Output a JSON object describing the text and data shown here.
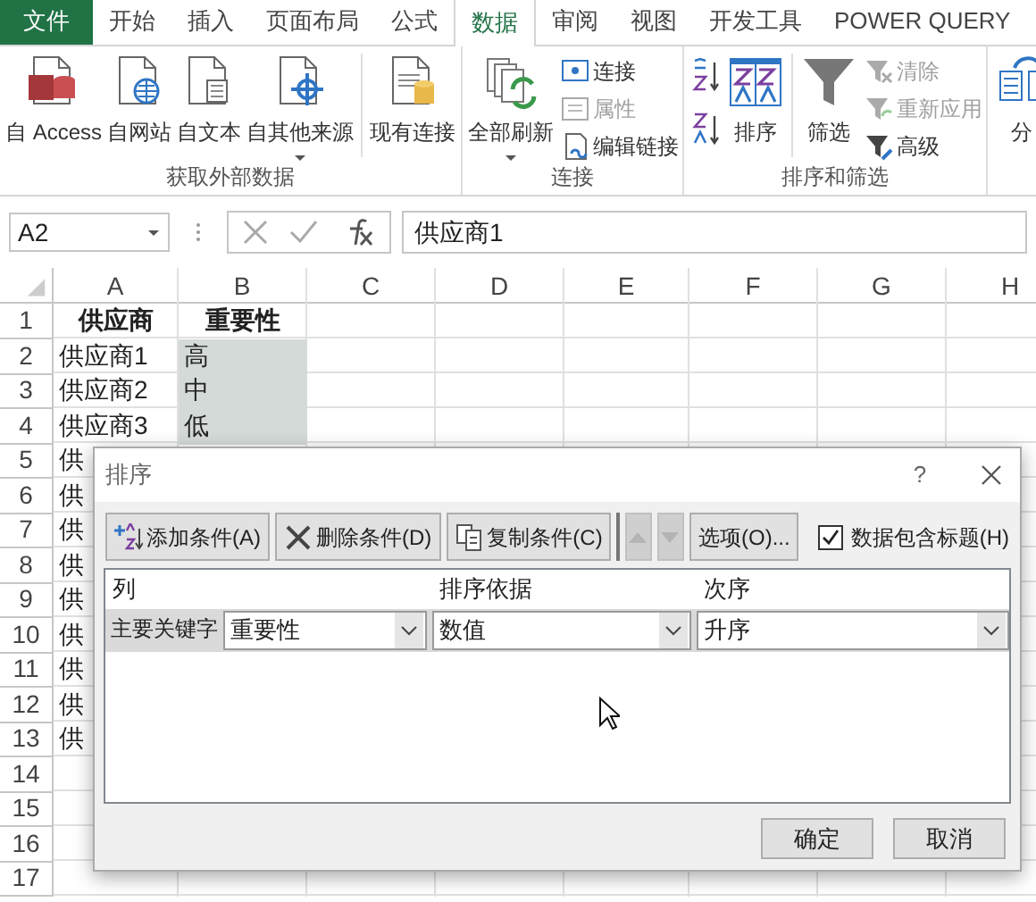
{
  "tabs": [
    {
      "label": "文件",
      "kind": "file",
      "selected": false
    },
    {
      "label": "开始",
      "kind": "tab",
      "selected": false
    },
    {
      "label": "插入",
      "kind": "tab",
      "selected": false
    },
    {
      "label": "页面布局",
      "kind": "tab",
      "selected": false
    },
    {
      "label": "公式",
      "kind": "tab",
      "selected": false
    },
    {
      "label": "数据",
      "kind": "tab",
      "selected": true
    },
    {
      "label": "审阅",
      "kind": "tab",
      "selected": false
    },
    {
      "label": "视图",
      "kind": "tab",
      "selected": false
    },
    {
      "label": "开发工具",
      "kind": "tab",
      "selected": false
    },
    {
      "label": "POWER QUERY",
      "kind": "tab",
      "selected": false
    }
  ],
  "ribbon": {
    "groups": [
      {
        "label": "获取外部数据",
        "items": [
          {
            "kind": "large",
            "label": "自 Access",
            "has_menu": false
          },
          {
            "kind": "large",
            "label": "自网站",
            "has_menu": false
          },
          {
            "kind": "large",
            "label": "自文本",
            "has_menu": false
          },
          {
            "kind": "large",
            "label": "自其他来源",
            "has_menu": true
          },
          {
            "kind": "separator"
          },
          {
            "kind": "large",
            "label": "现有连接",
            "has_menu": false
          }
        ]
      },
      {
        "label": "连接",
        "items": [
          {
            "kind": "large",
            "label": "全部刷新",
            "has_menu": true
          },
          {
            "kind": "small-stack",
            "items": [
              {
                "label": "连接",
                "disabled": false
              },
              {
                "label": "属性",
                "disabled": true
              },
              {
                "label": "编辑链接",
                "disabled": false
              }
            ]
          }
        ]
      },
      {
        "label": "排序和筛选",
        "items": [
          {
            "kind": "sort-pair"
          },
          {
            "kind": "large",
            "label": "排序",
            "has_menu": false
          },
          {
            "kind": "separator"
          },
          {
            "kind": "large",
            "label": "筛选",
            "has_menu": false
          },
          {
            "kind": "small-stack",
            "items": [
              {
                "label": "清除",
                "disabled": true
              },
              {
                "label": "重新应用",
                "disabled": true
              },
              {
                "label": "高级",
                "disabled": false
              }
            ]
          }
        ]
      },
      {
        "items": [
          {
            "kind": "large",
            "label": "分"
          }
        ]
      }
    ]
  },
  "formula_bar": {
    "name_box": "A2",
    "formula": "供应商1"
  },
  "sheet": {
    "columns": [
      "A",
      "B",
      "C",
      "D",
      "E",
      "F",
      "G",
      "H"
    ],
    "rows": [
      {
        "header": "1",
        "kind": "header",
        "cells": [
          {
            "text": "供应商",
            "selected": false
          },
          {
            "text": "重要性",
            "selected": false
          }
        ]
      },
      {
        "header": "2",
        "kind": "data",
        "cells": [
          {
            "text": "供应商1",
            "selected": false
          },
          {
            "text": "高",
            "selected": true
          }
        ]
      },
      {
        "header": "3",
        "kind": "data",
        "cells": [
          {
            "text": "供应商2",
            "selected": false
          },
          {
            "text": "中",
            "selected": true
          }
        ]
      },
      {
        "header": "4",
        "kind": "data",
        "cells": [
          {
            "text": "供应商3",
            "selected": false
          },
          {
            "text": "低",
            "selected": true
          }
        ]
      },
      {
        "header": "5",
        "kind": "data",
        "cells": [
          {
            "text": "供",
            "selected": false
          }
        ]
      },
      {
        "header": "6",
        "kind": "data",
        "cells": [
          {
            "text": "供",
            "selected": false
          }
        ]
      },
      {
        "header": "7",
        "kind": "data",
        "cells": [
          {
            "text": "供",
            "selected": false
          }
        ]
      },
      {
        "header": "8",
        "kind": "data",
        "cells": [
          {
            "text": "供",
            "selected": false
          }
        ]
      },
      {
        "header": "9",
        "kind": "data",
        "cells": [
          {
            "text": "供",
            "selected": false
          }
        ]
      },
      {
        "header": "10",
        "kind": "data",
        "cells": [
          {
            "text": "供",
            "selected": false
          }
        ]
      },
      {
        "header": "11",
        "kind": "data",
        "cells": [
          {
            "text": "供",
            "selected": false
          }
        ]
      },
      {
        "header": "12",
        "kind": "data",
        "cells": [
          {
            "text": "供",
            "selected": false
          }
        ]
      },
      {
        "header": "13",
        "kind": "data",
        "cells": [
          {
            "text": "供",
            "selected": false
          }
        ]
      },
      {
        "header": "14",
        "cells": []
      },
      {
        "header": "15",
        "cells": []
      },
      {
        "header": "16",
        "cells": []
      },
      {
        "header": "17",
        "cells": []
      }
    ]
  },
  "sort_dialog": {
    "title": "排序",
    "help": "?",
    "toolbar": [
      {
        "kind": "button",
        "label": "添加条件(A)",
        "disabled": false
      },
      {
        "kind": "button",
        "label": "删除条件(D)",
        "disabled": false
      },
      {
        "kind": "button",
        "label": "复制条件(C)",
        "disabled": false
      },
      {
        "kind": "move-up",
        "disabled": true
      },
      {
        "kind": "move-down",
        "disabled": true
      },
      {
        "kind": "button",
        "label": "选项(O)...",
        "disabled": false
      }
    ],
    "has_headers": {
      "label": "数据包含标题(H)",
      "checked": true
    },
    "columns": [
      "列",
      "排序依据",
      "次序"
    ],
    "levels": [
      {
        "label": "主要关键字",
        "selected": true,
        "column": "重要性",
        "sort_on": "数值",
        "order": "升序"
      }
    ],
    "buttons": [
      "确定",
      "取消"
    ]
  }
}
